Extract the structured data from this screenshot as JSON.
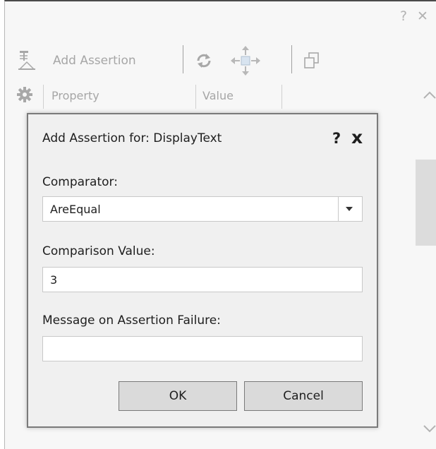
{
  "window": {
    "help_glyph": "?",
    "close_glyph": "✕"
  },
  "toolbar": {
    "add_assertion_label": "Add Assertion"
  },
  "properties_grid": {
    "columns": [
      "Property",
      "Value"
    ]
  },
  "dialog": {
    "title": "Add Assertion for: DisplayText",
    "help_glyph": "?",
    "close_glyph": "x",
    "comparator": {
      "label": "Comparator:",
      "selected": "AreEqual"
    },
    "comparison_value": {
      "label": "Comparison Value:",
      "value": "3"
    },
    "failure_message": {
      "label": "Message on Assertion Failure:",
      "value": ""
    },
    "ok_label": "OK",
    "cancel_label": "Cancel"
  }
}
